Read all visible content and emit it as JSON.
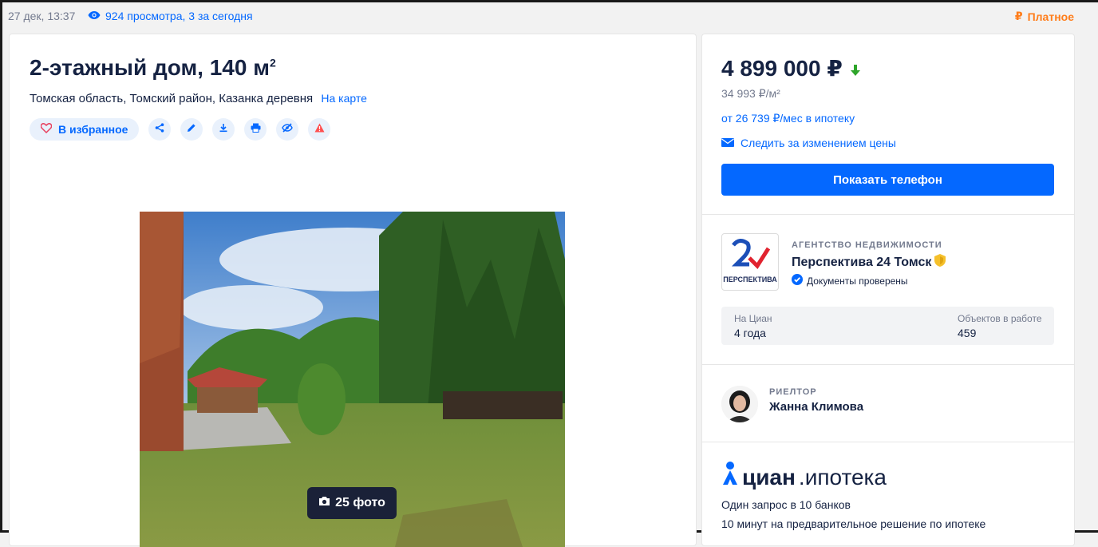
{
  "topbar": {
    "date": "27 дек, 13:37",
    "views": "924 просмотра, 3 за сегодня",
    "paid": "Платное"
  },
  "listing": {
    "title": "2-этажный дом, 140 м",
    "title_sup": "2",
    "address": "Томская область, Томский район, Казанка деревня",
    "map_link": "На карте",
    "favorite_label": "В избранное",
    "photo_count": "25 фото"
  },
  "price": {
    "value": "4 899 000 ₽",
    "per_meter": "34 993 ₽/м²",
    "mortgage": "от 26 739 ₽/мес в ипотеку",
    "track": "Следить за изменением цены",
    "phone_button": "Показать телефон"
  },
  "agency": {
    "kind": "АГЕНТСТВО НЕДВИЖИМОСТИ",
    "name": "Перспектива 24 Томск",
    "docs": "Документы проверены",
    "logo_text": "ПЕРСПЕКТИВА",
    "stat1_label": "На Циан",
    "stat1_value": "4 года",
    "stat2_label": "Объектов в работе",
    "stat2_value": "459"
  },
  "realtor": {
    "kind": "РИЕЛТОР",
    "name": "Жанна Климова"
  },
  "promo": {
    "brand_bold": "циан",
    "brand_rest": ".ипотека",
    "line1": "Один запрос в 10 банков",
    "line2": "10 минут на предварительное решение по ипотеке"
  },
  "colors": {
    "accent": "#0468ff",
    "paid": "#ff7d1a",
    "text": "#152242",
    "muted": "#737a8e",
    "price_down": "#2ea52a"
  }
}
